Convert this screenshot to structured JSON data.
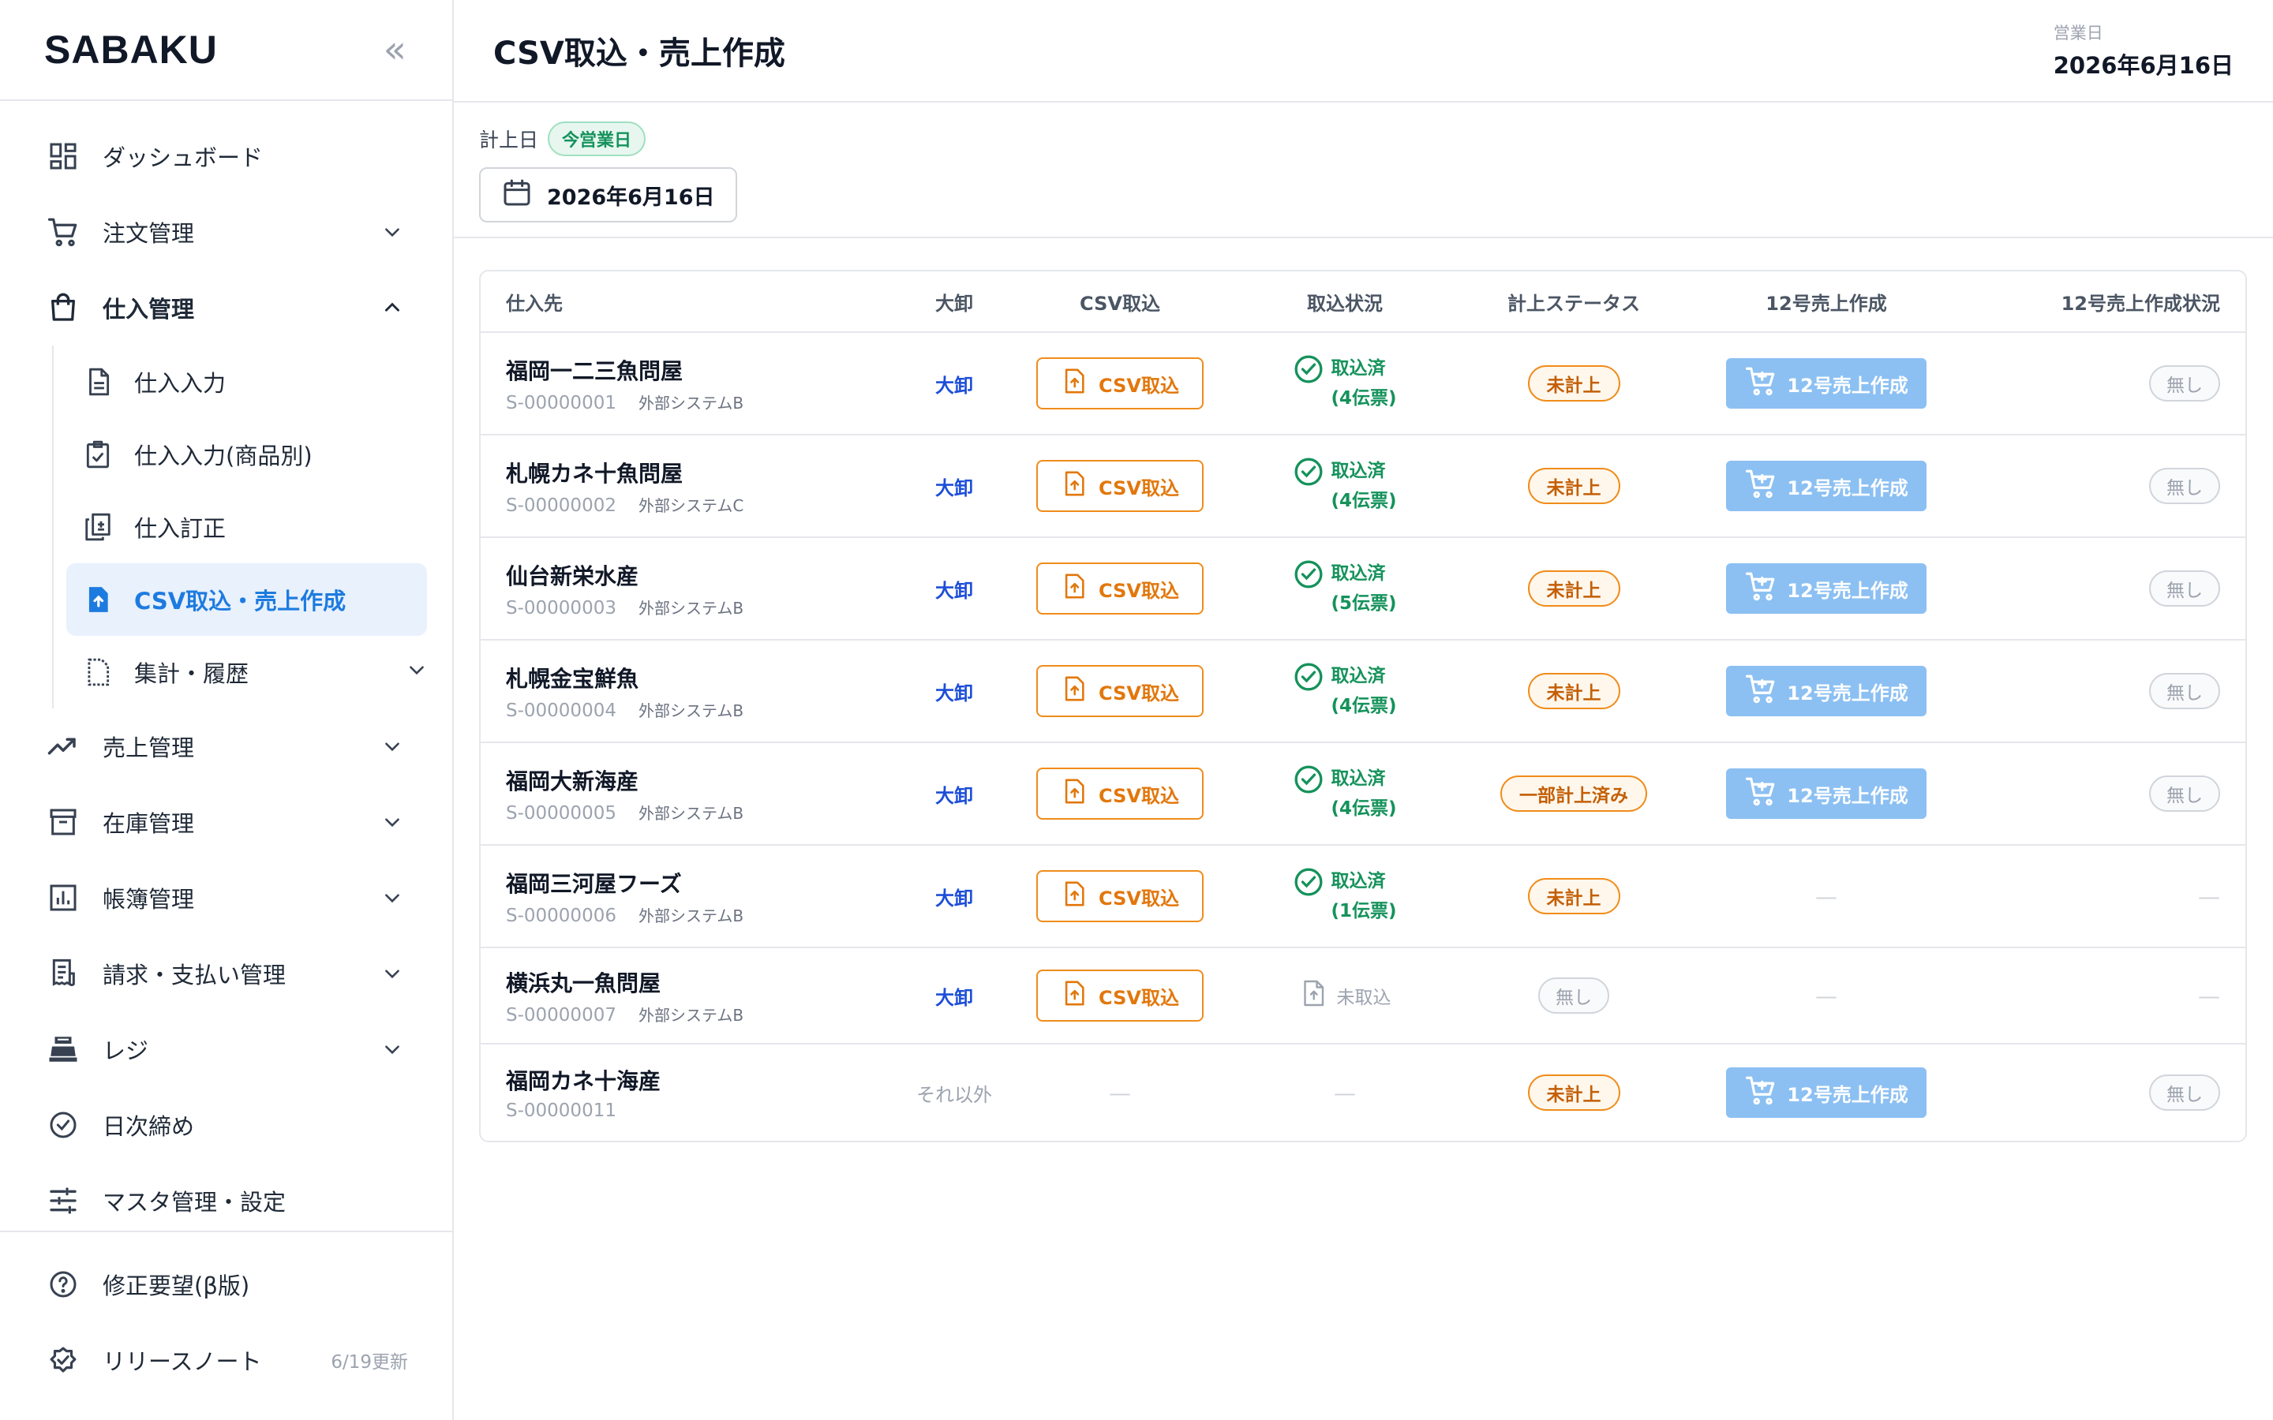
{
  "app": {
    "brand": "SABAKU",
    "collapse_glyph": "«"
  },
  "sidebar": {
    "items": [
      {
        "label": "ダッシュボード",
        "icon": "dashboard-icon"
      },
      {
        "label": "注文管理",
        "icon": "cart-icon",
        "expanded": false
      },
      {
        "label": "仕入管理",
        "icon": "bag-icon",
        "expanded": true
      },
      {
        "label": "売上管理",
        "icon": "trend-icon",
        "expanded": false
      },
      {
        "label": "在庫管理",
        "icon": "archive-icon",
        "expanded": false
      },
      {
        "label": "帳簿管理",
        "icon": "ledger-icon",
        "expanded": false
      },
      {
        "label": "請求・支払い管理",
        "icon": "receipt-icon",
        "expanded": false
      },
      {
        "label": "レジ",
        "icon": "register-icon",
        "expanded": false
      },
      {
        "label": "日次締め",
        "icon": "check-circle-icon"
      },
      {
        "label": "マスタ管理・設定",
        "icon": "sliders-icon"
      }
    ],
    "subitems": [
      {
        "label": "仕入入力",
        "icon": "document-icon"
      },
      {
        "label": "仕入入力(商品別)",
        "icon": "clipboard-check-icon"
      },
      {
        "label": "仕入訂正",
        "icon": "copy-edit-icon"
      },
      {
        "label": "CSV取込・売上作成",
        "icon": "file-upload-icon",
        "active": true
      },
      {
        "label": "集計・履歴",
        "icon": "report-icon"
      }
    ],
    "bottom": [
      {
        "label": "修正要望(β版)",
        "icon": "help-circle-icon"
      },
      {
        "label": "リリースノート",
        "icon": "badge-check-icon",
        "note": "6/19更新"
      }
    ]
  },
  "header": {
    "title": "CSV取込・売上作成",
    "bizday_label": "営業日",
    "bizday_value": "2026年6月16日"
  },
  "filter": {
    "label": "計上日",
    "today_tag": "今営業日",
    "date_value": "2026年6月16日"
  },
  "table": {
    "columns": [
      "仕入先",
      "大卸",
      "CSV取込",
      "取込状況",
      "計上ステータス",
      "12号売上作成",
      "12号売上作成状況"
    ],
    "csv_button": "CSV取込",
    "sales_button": "12号売上作成",
    "status_done": "取込済",
    "status_none": "未取込",
    "none_label": "無し",
    "dash": "—",
    "rows": [
      {
        "name": "福岡一二三魚問屋",
        "code": "S-00000001",
        "system": "外部システムB",
        "tier": "大卸",
        "csv": true,
        "import": "done",
        "slips": "(4伝票)",
        "status": "未計上",
        "sales": true,
        "sales_status": "無し"
      },
      {
        "name": "札幌カネ十魚問屋",
        "code": "S-00000002",
        "system": "外部システムC",
        "tier": "大卸",
        "csv": true,
        "import": "done",
        "slips": "(4伝票)",
        "status": "未計上",
        "sales": true,
        "sales_status": "無し"
      },
      {
        "name": "仙台新栄水産",
        "code": "S-00000003",
        "system": "外部システムB",
        "tier": "大卸",
        "csv": true,
        "import": "done",
        "slips": "(5伝票)",
        "status": "未計上",
        "sales": true,
        "sales_status": "無し"
      },
      {
        "name": "札幌金宝鮮魚",
        "code": "S-00000004",
        "system": "外部システムB",
        "tier": "大卸",
        "csv": true,
        "import": "done",
        "slips": "(4伝票)",
        "status": "未計上",
        "sales": true,
        "sales_status": "無し"
      },
      {
        "name": "福岡大新海産",
        "code": "S-00000005",
        "system": "外部システムB",
        "tier": "大卸",
        "csv": true,
        "import": "done",
        "slips": "(4伝票)",
        "status": "一部計上済み",
        "sales": true,
        "sales_status": "無し"
      },
      {
        "name": "福岡三河屋フーズ",
        "code": "S-00000006",
        "system": "外部システムB",
        "tier": "大卸",
        "csv": true,
        "import": "done",
        "slips": "(1伝票)",
        "status": "未計上",
        "sales": false,
        "sales_status": ""
      },
      {
        "name": "横浜丸一魚問屋",
        "code": "S-00000007",
        "system": "外部システムB",
        "tier": "大卸",
        "csv": true,
        "import": "none",
        "slips": "",
        "status": "無し",
        "sales": false,
        "sales_status": ""
      },
      {
        "name": "福岡カネ十海産",
        "code": "S-00000011",
        "system": "",
        "tier": "それ以外",
        "csv": false,
        "import": "dash",
        "slips": "",
        "status": "未計上",
        "sales": true,
        "sales_status": "無し"
      }
    ]
  },
  "colors": {
    "accent": "#1d7be0",
    "orange": "#f08c1a",
    "green": "#15925b",
    "sales_btn": "#8cc0f2"
  }
}
